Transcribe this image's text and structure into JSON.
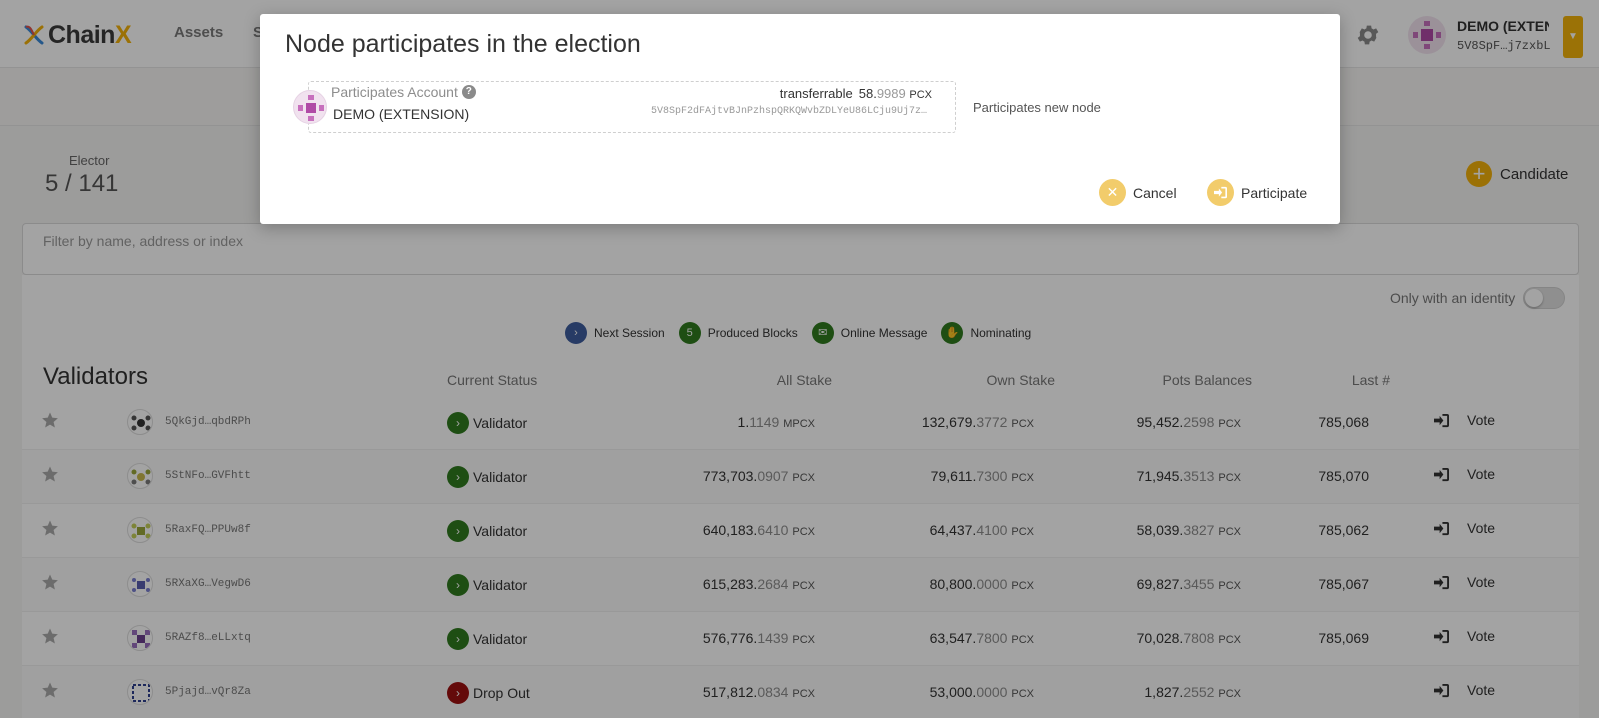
{
  "app": {
    "logo_main": "Chain",
    "logo_accent": "X"
  },
  "nav": {
    "assets": "Assets",
    "second": "S"
  },
  "account": {
    "name": "DEMO (EXTENSION)",
    "address": "5V8SpF…j7zxbL"
  },
  "elector": {
    "label": "Elector",
    "count": "5 / 141"
  },
  "candidate_label": "Candidate",
  "filter_placeholder": "Filter by name, address or index",
  "identity_toggle_label": "Only with an identity",
  "legend": [
    {
      "badge": "›",
      "label": "Next Session",
      "color": "#3e5d9e"
    },
    {
      "badge": "5",
      "label": "Produced Blocks",
      "color": "#2f7a1f"
    },
    {
      "badge": "✉",
      "label": "Online Message",
      "color": "#2f7a1f"
    },
    {
      "badge": "✋",
      "label": "Nominating",
      "color": "#2f7a1f"
    }
  ],
  "table": {
    "title": "Validators",
    "headers": {
      "status": "Current Status",
      "all": "All Stake",
      "own": "Own Stake",
      "pots": "Pots Balances",
      "last": "Last #"
    },
    "vote_label": "Vote",
    "rows": [
      {
        "addr": "5QkGjd…qbdRPh",
        "status": "Validator",
        "all_int": "1.",
        "all_frac": "1149",
        "all_unit": "MPCX",
        "own_int": "132,679.",
        "own_frac": "3772",
        "own_unit": "PCX",
        "pots_int": "95,452.",
        "pots_frac": "2598",
        "pots_unit": "PCX",
        "last": "785,068"
      },
      {
        "addr": "5StNFo…GVFhtt",
        "status": "Validator",
        "all_int": "773,703.",
        "all_frac": "0907",
        "all_unit": "PCX",
        "own_int": "79,611.",
        "own_frac": "7300",
        "own_unit": "PCX",
        "pots_int": "71,945.",
        "pots_frac": "3513",
        "pots_unit": "PCX",
        "last": "785,070"
      },
      {
        "addr": "5RaxFQ…PPUw8f",
        "status": "Validator",
        "all_int": "640,183.",
        "all_frac": "6410",
        "all_unit": "PCX",
        "own_int": "64,437.",
        "own_frac": "4100",
        "own_unit": "PCX",
        "pots_int": "58,039.",
        "pots_frac": "3827",
        "pots_unit": "PCX",
        "last": "785,062"
      },
      {
        "addr": "5RXaXG…VegwD6",
        "status": "Validator",
        "all_int": "615,283.",
        "all_frac": "2684",
        "all_unit": "PCX",
        "own_int": "80,800.",
        "own_frac": "0000",
        "own_unit": "PCX",
        "pots_int": "69,827.",
        "pots_frac": "3455",
        "pots_unit": "PCX",
        "last": "785,067"
      },
      {
        "addr": "5RAZf8…eLLxtq",
        "status": "Validator",
        "all_int": "576,776.",
        "all_frac": "1439",
        "all_unit": "PCX",
        "own_int": "63,547.",
        "own_frac": "7800",
        "own_unit": "PCX",
        "pots_int": "70,028.",
        "pots_frac": "7808",
        "pots_unit": "PCX",
        "last": "785,069"
      },
      {
        "addr": "5Pjajd…vQr8Za",
        "status": "Drop Out",
        "all_int": "517,812.",
        "all_frac": "0834",
        "all_unit": "PCX",
        "own_int": "53,000.",
        "own_frac": "0000",
        "own_unit": "PCX",
        "pots_int": "1,827.",
        "pots_frac": "2552",
        "pots_unit": "PCX",
        "last": ""
      }
    ]
  },
  "modal": {
    "title": "Node participates in the election",
    "account_label": "Participates Account",
    "account_name": "DEMO (EXTENSION)",
    "transferrable_label": "transferrable",
    "balance_int": "58.",
    "balance_frac": "9989",
    "balance_unit": "PCX",
    "account_address": "5V8SpF2dFAjtvBJnPzhspQRKQWvbZDLYeU86LCju9Uj7z…",
    "hint": "Participates new node",
    "cancel_label": "Cancel",
    "participate_label": "Participate"
  },
  "colors": {
    "accent": "#f3b10a",
    "validator": "#2f7a1f",
    "dropout": "#9d1010",
    "overlay": "rgba(0,0,0,0.36)"
  }
}
